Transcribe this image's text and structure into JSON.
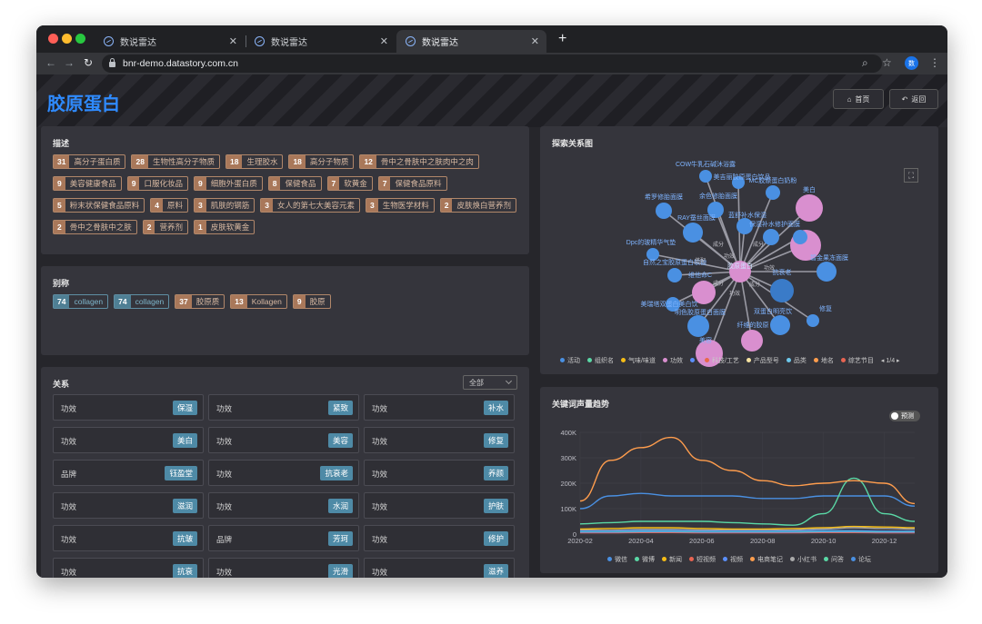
{
  "browser": {
    "tabs": [
      {
        "title": "数说雷达"
      },
      {
        "title": "数说雷达"
      },
      {
        "title": "数说雷达"
      }
    ],
    "url": "bnr-demo.datastory.com.cn",
    "profile_initial": "数"
  },
  "page": {
    "title": "胶原蛋白",
    "home_label": "首页",
    "back_label": "返回"
  },
  "description_panel": {
    "title": "描述",
    "tags": [
      {
        "count": "31",
        "text": "高分子蛋白质"
      },
      {
        "count": "28",
        "text": "生物性高分子物质"
      },
      {
        "count": "18",
        "text": "生理胶水"
      },
      {
        "count": "18",
        "text": "高分子物质"
      },
      {
        "count": "12",
        "text": "骨中之骨肤中之肤肉中之肉"
      },
      {
        "count": "9",
        "text": "美容健康食品"
      },
      {
        "count": "9",
        "text": "口服化妆品"
      },
      {
        "count": "9",
        "text": "细胞外蛋白质"
      },
      {
        "count": "8",
        "text": "保健食品"
      },
      {
        "count": "7",
        "text": "软黄金"
      },
      {
        "count": "7",
        "text": "保健食品原料"
      },
      {
        "count": "5",
        "text": "粉末状保健食品原料"
      },
      {
        "count": "4",
        "text": "原料"
      },
      {
        "count": "3",
        "text": "肌肤的钢筋"
      },
      {
        "count": "3",
        "text": "女人的第七大美容元素"
      },
      {
        "count": "3",
        "text": "生物医学材料"
      },
      {
        "count": "2",
        "text": "皮肤焕白营养剂"
      },
      {
        "count": "2",
        "text": "骨中之骨肤中之肤"
      },
      {
        "count": "2",
        "text": "营养剂"
      },
      {
        "count": "1",
        "text": "皮肤软黄金"
      }
    ]
  },
  "alias_panel": {
    "title": "别称",
    "tags": [
      {
        "count": "74",
        "text": "collagen",
        "kind": "blue"
      },
      {
        "count": "74",
        "text": "collagen",
        "kind": "blue"
      },
      {
        "count": "37",
        "text": "胶原质",
        "kind": "brown"
      },
      {
        "count": "13",
        "text": "Kollagen",
        "kind": "brown"
      },
      {
        "count": "9",
        "text": "胶原",
        "kind": "brown"
      }
    ]
  },
  "relation_panel": {
    "title": "关系",
    "filter_value": "全部",
    "cells": [
      {
        "label": "功效",
        "value": "保湿"
      },
      {
        "label": "功效",
        "value": "紧致"
      },
      {
        "label": "功效",
        "value": "补水"
      },
      {
        "label": "功效",
        "value": "美白"
      },
      {
        "label": "功效",
        "value": "美容"
      },
      {
        "label": "功效",
        "value": "修复"
      },
      {
        "label": "品牌",
        "value": "钰盈堂"
      },
      {
        "label": "功效",
        "value": "抗衰老"
      },
      {
        "label": "功效",
        "value": "养颜"
      },
      {
        "label": "功效",
        "value": "滋润"
      },
      {
        "label": "功效",
        "value": "水润"
      },
      {
        "label": "功效",
        "value": "护肤"
      },
      {
        "label": "功效",
        "value": "抗皱"
      },
      {
        "label": "品牌",
        "value": "芳珂"
      },
      {
        "label": "功效",
        "value": "修护"
      },
      {
        "label": "功效",
        "value": "抗衰"
      },
      {
        "label": "功效",
        "value": "光滑"
      },
      {
        "label": "功效",
        "value": "滋养"
      }
    ]
  },
  "graph_panel": {
    "title": "探索关系图",
    "center_label": "胶原蛋白",
    "node_labels": [
      "COW牛乳石碱沐浴露",
      "美吉丽胶原蛋白饮品",
      "MC胶原蛋白奶粉",
      "希罗修胎面膜",
      "余色修胎面膜",
      "美白",
      "RAY蚕丝面膜",
      "蓝舒补水保湿",
      "保湿补水修护面膜",
      "Dpc的玻精华气垫",
      "自然之宝胶原蛋白软糖",
      "碧金果冻面膜",
      "抗衰老",
      "美瑞塔双蛋白美白饮",
      "维他命C",
      "修复",
      "双蛋白明亮饮",
      "明色胶原蛋白面膜",
      "纤维的胶原",
      "美容"
    ],
    "edge_labels": [
      "成分",
      "功效",
      "搭配",
      "成分",
      "功效",
      "成分",
      "功效",
      "成分"
    ],
    "legend": [
      "活动",
      "组织名",
      "气味/味道",
      "功效",
      "",
      "科技/工艺",
      "产品型号",
      "品类",
      "地名",
      "综艺节目"
    ],
    "legend_colors": [
      "#4a90e2",
      "#5ad8a6",
      "#f6bd16",
      "#d98fcf",
      "#5b8ff9",
      "#e8684a",
      "#f6e3a1",
      "#6dc8ec",
      "#ff9d4d",
      "#e86452"
    ],
    "page_indicator": "1/4"
  },
  "trend_panel": {
    "title": "关键词声量趋势",
    "toggle_label": "预测",
    "chart_data": {
      "type": "line",
      "x": [
        "2020-02",
        "2020-03",
        "2020-04",
        "2020-05",
        "2020-06",
        "2020-07",
        "2020-08",
        "2020-09",
        "2020-10",
        "2020-11",
        "2020-12",
        "2021-01"
      ],
      "xticks": [
        "2020-02",
        "2020-04",
        "2020-06",
        "2020-08",
        "2020-10",
        "2020-12"
      ],
      "yticks": [
        "0",
        "100K",
        "200K",
        "300K",
        "400K"
      ],
      "ylim": [
        0,
        400000
      ],
      "series": [
        {
          "name": "微信",
          "color": "#4a90e2",
          "values": [
            100000,
            150000,
            160000,
            150000,
            150000,
            150000,
            140000,
            140000,
            150000,
            150000,
            150000,
            110000
          ]
        },
        {
          "name": "微博",
          "color": "#5ad8a6",
          "values": [
            40000,
            45000,
            50000,
            50000,
            50000,
            45000,
            40000,
            35000,
            80000,
            220000,
            80000,
            50000
          ]
        },
        {
          "name": "新闻",
          "color": "#f6bd16",
          "values": [
            20000,
            22000,
            25000,
            25000,
            22000,
            20000,
            20000,
            22000,
            25000,
            30000,
            28000,
            25000
          ]
        },
        {
          "name": "短视频",
          "color": "#e86452",
          "values": [
            5000,
            5000,
            6000,
            6000,
            5000,
            5000,
            5000,
            5000,
            6000,
            6000,
            5000,
            5000
          ]
        },
        {
          "name": "视频",
          "color": "#5b8ff9",
          "values": [
            8000,
            8000,
            9000,
            9000,
            8000,
            8000,
            8000,
            8000,
            9000,
            9000,
            8000,
            8000
          ]
        },
        {
          "name": "电商笔记",
          "color": "#ff9d4d",
          "values": [
            130000,
            290000,
            340000,
            380000,
            290000,
            250000,
            210000,
            190000,
            200000,
            210000,
            200000,
            120000
          ]
        },
        {
          "name": "小红书",
          "color": "#aaaaaa",
          "values": [
            15000,
            15000,
            18000,
            18000,
            16000,
            15000,
            15000,
            16000,
            20000,
            25000,
            22000,
            20000
          ]
        },
        {
          "name": "问答",
          "color": "#5ad8a6",
          "values": [
            10000,
            10000,
            12000,
            12000,
            10000,
            10000,
            10000,
            10000,
            12000,
            12000,
            10000,
            10000
          ]
        },
        {
          "name": "论坛",
          "color": "#4a90e2",
          "values": [
            12000,
            12000,
            14000,
            14000,
            12000,
            12000,
            12000,
            12000,
            14000,
            14000,
            12000,
            12000
          ]
        }
      ]
    }
  }
}
